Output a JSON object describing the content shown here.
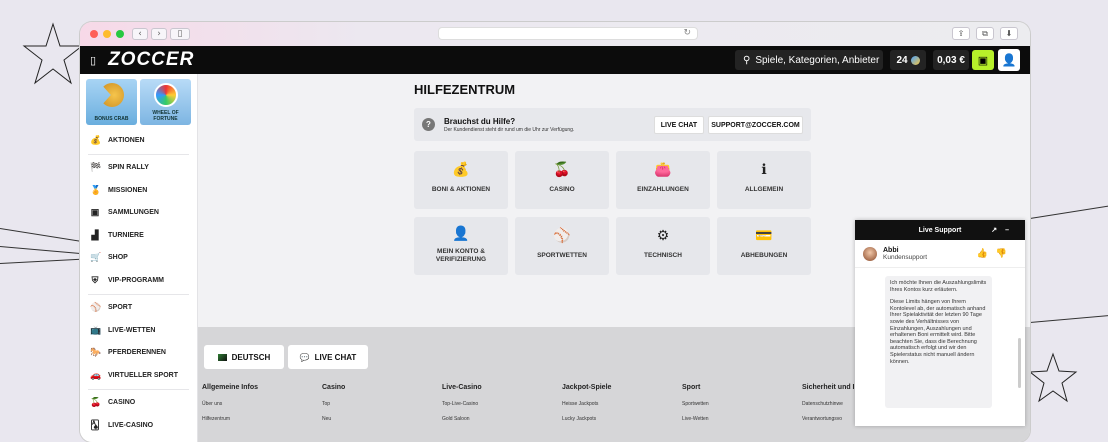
{
  "browser": {
    "address": "↻",
    "back": "‹",
    "forward": "›",
    "sidebar": "▯",
    "share": "⇪",
    "tabs": "⧉",
    "download": "⬇"
  },
  "topnav": {
    "logo": "ZOCCER",
    "search_placeholder": "Spiele, Kategorien, Anbieter",
    "coins": "24",
    "balance": "0,03 €"
  },
  "sidebar": {
    "tiles": [
      {
        "label": "BONUS CRAB"
      },
      {
        "label": "WHEEL OF FORTUNE"
      }
    ],
    "items": [
      {
        "label": "AKTIONEN",
        "icon": "money-bag-icon",
        "glyph": "💰"
      },
      {
        "label": "SPIN RALLY",
        "icon": "flags-icon",
        "glyph": "🏁"
      },
      {
        "label": "MISSIONEN",
        "icon": "medal-icon",
        "glyph": "🏅"
      },
      {
        "label": "SAMMLUNGEN",
        "icon": "collection-icon",
        "glyph": "▣"
      },
      {
        "label": "TURNIERE",
        "icon": "podium-icon",
        "glyph": "▟"
      },
      {
        "label": "SHOP",
        "icon": "cart-icon",
        "glyph": "🛒"
      },
      {
        "label": "VIP-PROGRAMM",
        "icon": "shield-icon",
        "glyph": "⛨"
      },
      {
        "label": "SPORT",
        "icon": "ball-icon",
        "glyph": "⚾"
      },
      {
        "label": "LIVE-WETTEN",
        "icon": "live-tv-icon",
        "glyph": "📺"
      },
      {
        "label": "PFERDERENNEN",
        "icon": "horse-icon",
        "glyph": "🐎"
      },
      {
        "label": "VIRTUELLER SPORT",
        "icon": "car-icon",
        "glyph": "🚗"
      },
      {
        "label": "CASINO",
        "icon": "cherries-icon",
        "glyph": "🍒"
      },
      {
        "label": "LIVE-CASINO",
        "icon": "cards-icon",
        "glyph": "🂡"
      }
    ]
  },
  "main": {
    "title": "HILFEZENTRUM",
    "help_heading": "Brauchst du Hilfe?",
    "help_sub": "Der Kundendienst steht dir rund um die Uhr zur Verfügung.",
    "live_chat_label": "LIVE CHAT",
    "support_email": "SUPPORT@ZOCCER.COM",
    "categories": [
      {
        "label": "BONI & AKTIONEN",
        "icon": "money-bag-icon",
        "glyph": "💰"
      },
      {
        "label": "CASINO",
        "icon": "cherries-icon",
        "glyph": "🍒"
      },
      {
        "label": "EINZAHLUNGEN",
        "icon": "wallet-icon",
        "glyph": "👛"
      },
      {
        "label": "ALLGEMEIN",
        "icon": "info-icon",
        "glyph": "ℹ"
      },
      {
        "label": "MEIN KONTO & VERIFIZIERUNG",
        "icon": "person-icon",
        "glyph": "👤"
      },
      {
        "label": "SPORTWETTEN",
        "icon": "ball-icon",
        "glyph": "⚾"
      },
      {
        "label": "TECHNISCH",
        "icon": "gear-icon",
        "glyph": "⚙"
      },
      {
        "label": "ABHEBUNGEN",
        "icon": "credit-card-icon",
        "glyph": "💳"
      }
    ]
  },
  "footer": {
    "language_label": "DEUTSCH",
    "live_chat_label": "LIVE CHAT",
    "columns": [
      {
        "heading": "Allgemeine Infos",
        "links": [
          "Über uns",
          "Hilfezentrum"
        ]
      },
      {
        "heading": "Casino",
        "links": [
          "Top",
          "Neu"
        ]
      },
      {
        "heading": "Live-Casino",
        "links": [
          "Top-Live-Casino",
          "Gold Saloon"
        ]
      },
      {
        "heading": "Jackpot-Spiele",
        "links": [
          "Heisse Jackpots",
          "Lucky Jackpots"
        ]
      },
      {
        "heading": "Sport",
        "links": [
          "Sportwetten",
          "Live-Wetten"
        ]
      },
      {
        "heading": "Sicherheit und I",
        "links": [
          "Datenschutzhinwe",
          "Verantwortungsvo"
        ]
      }
    ]
  },
  "chat": {
    "title": "Live Support",
    "agent_name": "Abbi",
    "agent_role": "Kundensupport",
    "message_p1": "Ich möchte Ihnen die Auszahlungslimits Ihres Kontos kurz erläutern.",
    "message_p2": "Diese Limits hängen von Ihrem Kontolevel ab, der automatisch anhand Ihrer Spielaktivität der letzten 90 Tage sowie des Verhältnisses von Einzahlungen, Auszahlungen und erhaltenen Boni ermittelt wird. Bitte beachten Sie, dass die Berechnung automatisch erfolgt und wir den Spielerstatus nicht manuell ändern können."
  }
}
